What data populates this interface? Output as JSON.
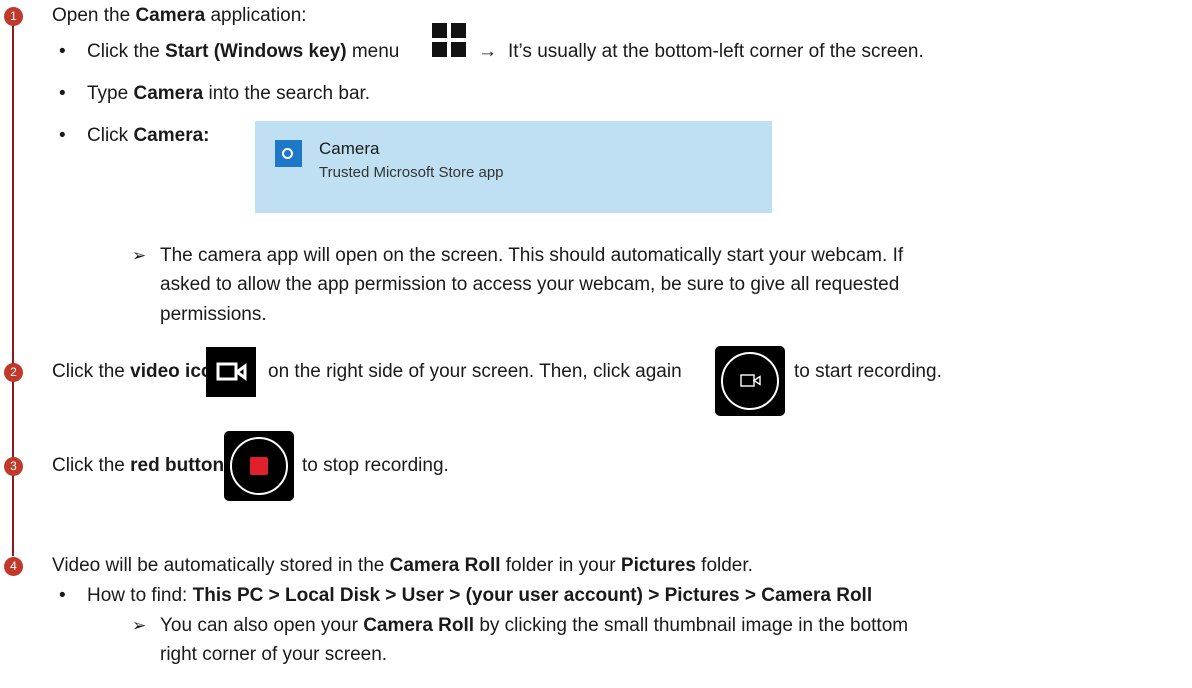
{
  "steps": [
    {
      "number": "1"
    },
    {
      "number": "2"
    },
    {
      "number": "3"
    },
    {
      "number": "4"
    }
  ],
  "step1": {
    "intro_pre": "Open the ",
    "intro_bold": "Camera",
    "intro_post": " application:",
    "b1_pre": "Click the ",
    "b1_bold": "Start (Windows key)",
    "b1_mid": " menu",
    "b1_arrow": "→",
    "b1_post": "It’s usually at the bottom-left corner of the screen.",
    "b2_pre": "Type ",
    "b2_bold": "Camera",
    "b2_post": " into the search bar.",
    "b3_pre": "Click ",
    "b3_bold": "Camera:",
    "tile_title": "Camera",
    "tile_subtitle": "Trusted Microsoft Store app",
    "note_l1": "The camera app will open on the screen. This should automatically start your webcam. If",
    "note_l2": "asked to allow the app permission to access your webcam, be sure to give all requested",
    "note_l3": "permissions."
  },
  "step2": {
    "pre": "Click the ",
    "bold": "video icon",
    "mid": "on the right side of your screen. Then, click again",
    "post": "to start recording."
  },
  "step3": {
    "pre": "Click the ",
    "bold": "red button",
    "post": "to stop recording."
  },
  "step4": {
    "l1_pre": "Video will be automatically stored in the ",
    "l1_bold1": "Camera Roll",
    "l1_mid": " folder in your ",
    "l1_bold2": "Pictures",
    "l1_post": " folder.",
    "b1_pre": "How to find: ",
    "b1_bold": "This PC > Local Disk > User > (your user account) > Pictures > Camera Roll",
    "sub_pre": "You can also open your ",
    "sub_bold": "Camera Roll",
    "sub_post1": " by clicking the small thumbnail image in the bottom",
    "sub_post2": "right corner of your screen."
  },
  "glyphs": {
    "bullet": "•",
    "sub_bullet": "➢"
  },
  "icons": [
    "windows-start-icon",
    "camera-app-icon",
    "video-mode-icon",
    "record-button-icon",
    "stop-button-icon"
  ],
  "colors": {
    "accent": "#c0392b",
    "rail": "#8b1c1c",
    "tile_bg": "#bfe0f3",
    "camera_icon": "#1e78c8",
    "stop_red": "#e0202a"
  }
}
